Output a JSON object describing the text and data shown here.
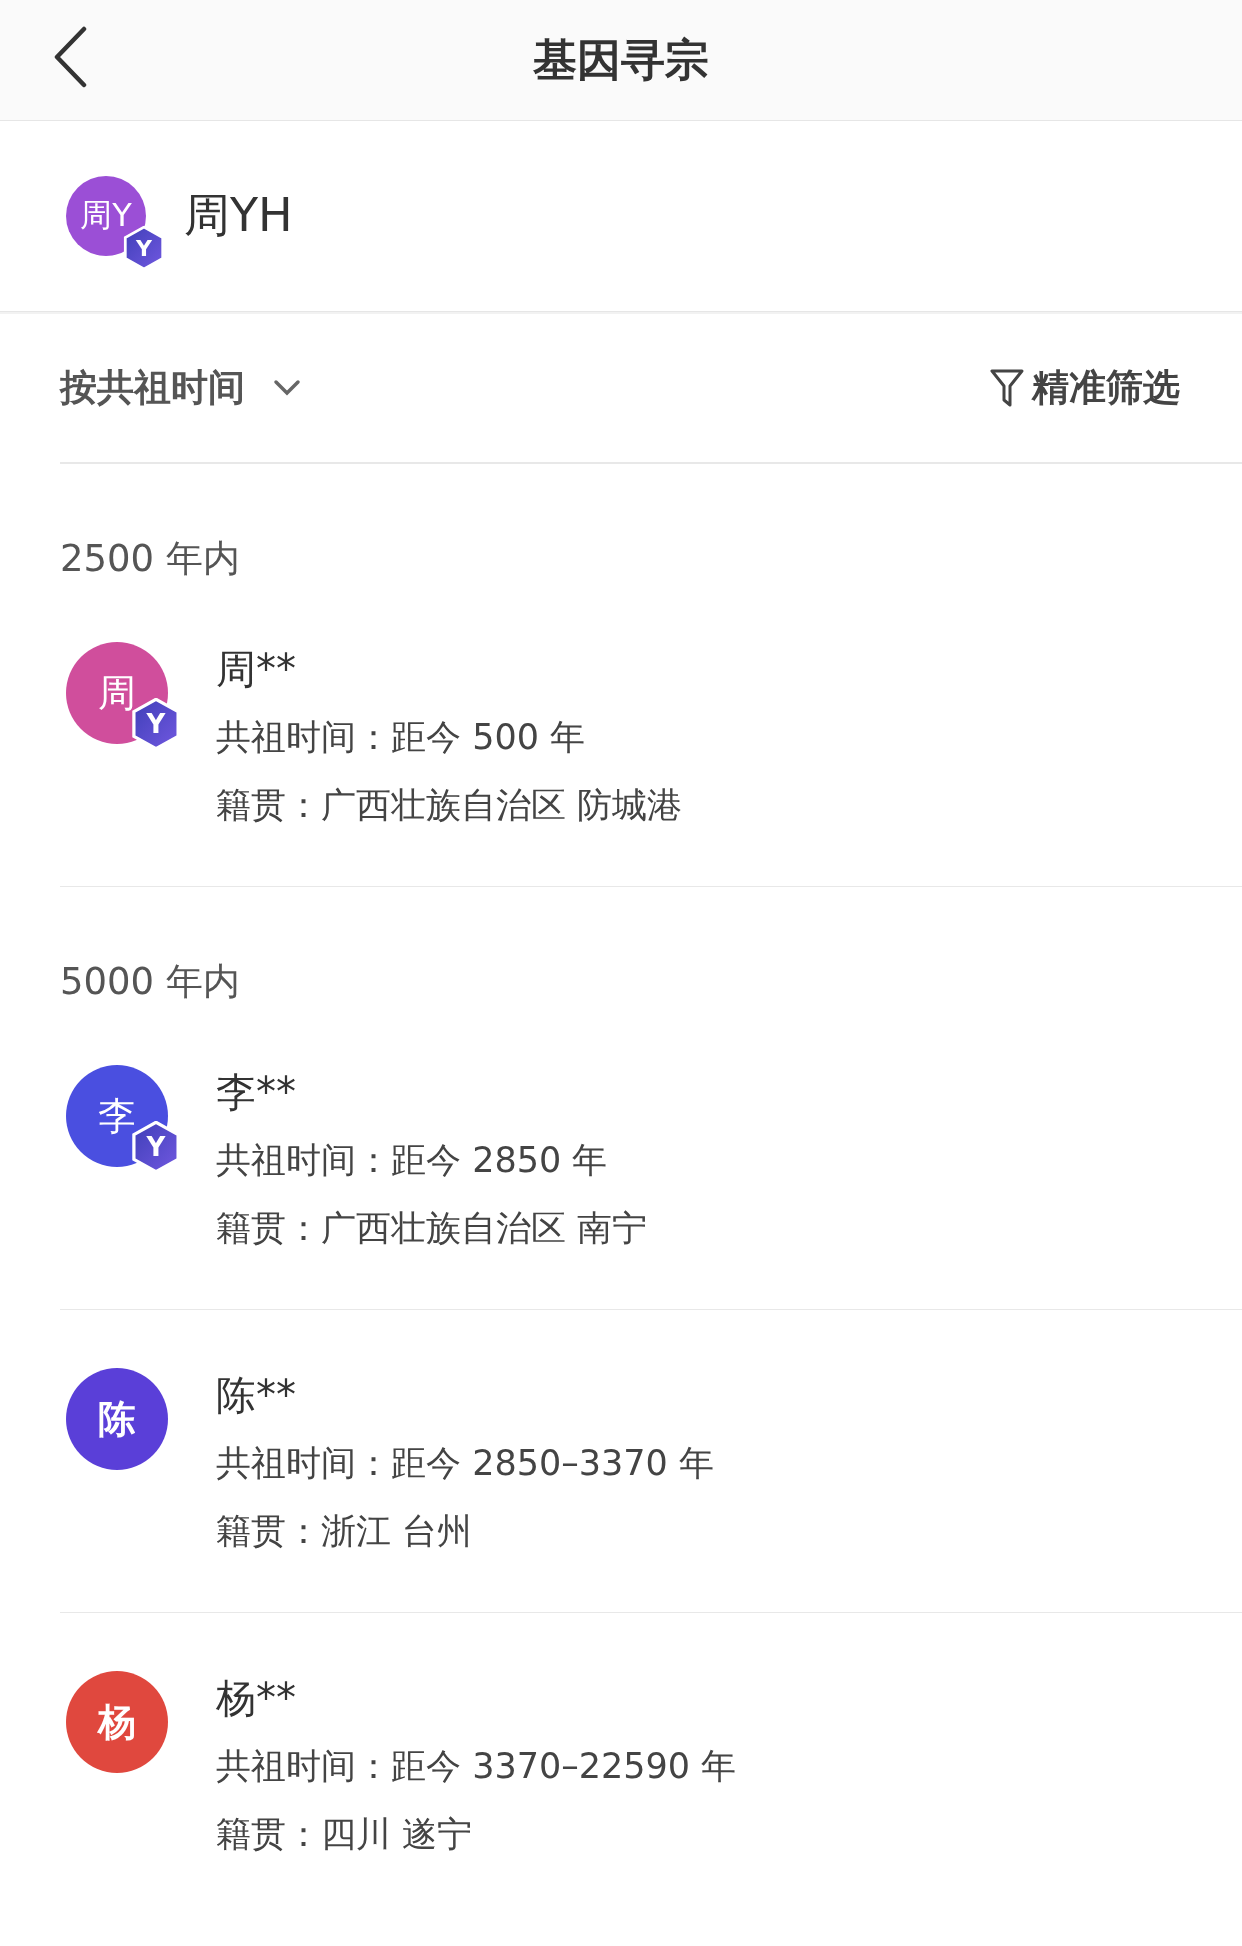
{
  "header": {
    "title": "基因寻宗"
  },
  "profile": {
    "avatar": "周Y",
    "badge": "Y",
    "color": "#9b4fd6",
    "name": "周YH"
  },
  "toolbar": {
    "sort": "按共祖时间",
    "filter": "精准筛选"
  },
  "sections": [
    {
      "title": "2500 年内",
      "matches": [
        {
          "avatar": "周",
          "badge": "Y",
          "color": "#d04e9c",
          "name": "周**",
          "time_label": "共祖时间：",
          "time": "距今 500 年",
          "origin_label": "籍贯：",
          "origin": "广西壮族自治区 防城港"
        }
      ]
    },
    {
      "title": "5000 年内",
      "matches": [
        {
          "avatar": "李",
          "badge": "Y",
          "color": "#4a4fe0",
          "name": "李**",
          "time_label": "共祖时间：",
          "time": "距今 2850 年",
          "origin_label": "籍贯：",
          "origin": "广西壮族自治区 南宁"
        },
        {
          "avatar": "陈",
          "color": "#5a3fd8",
          "name": "陈**",
          "time_label": "共祖时间：",
          "time": "距今 2850–3370 年",
          "origin_label": "籍贯：",
          "origin": "浙江 台州"
        },
        {
          "avatar": "杨",
          "color": "#e0483e",
          "name": "杨**",
          "time_label": "共祖时间：",
          "time": "距今 3370–22590 年",
          "origin_label": "籍贯：",
          "origin": "四川 遂宁"
        }
      ]
    }
  ]
}
